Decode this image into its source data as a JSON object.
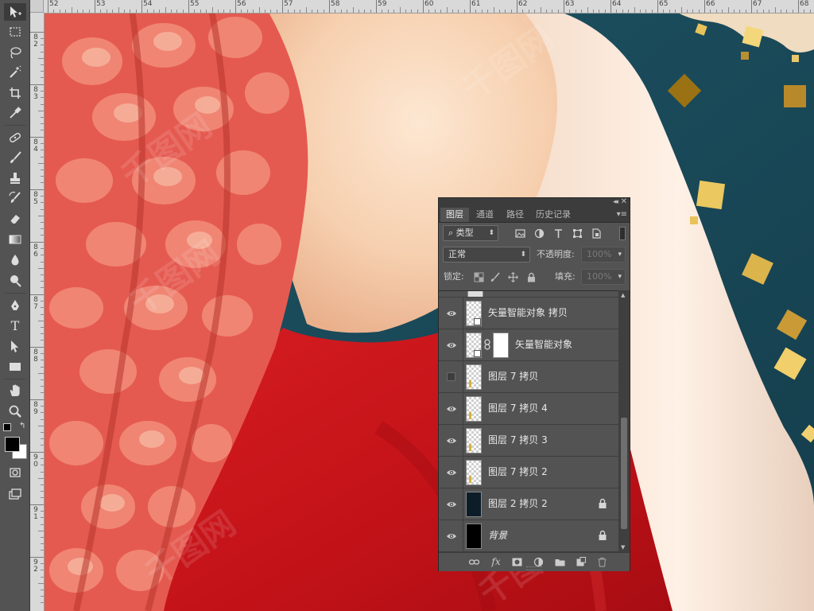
{
  "toolbar": {
    "tools": [
      "move-tool",
      "marquee-tool",
      "lasso-tool",
      "magic-wand-tool",
      "crop-tool",
      "eyedropper-tool",
      "healing-brush-tool",
      "brush-tool",
      "clone-stamp-tool",
      "history-brush-tool",
      "eraser-tool",
      "gradient-tool",
      "blur-tool",
      "dodge-tool",
      "pen-tool",
      "type-tool",
      "path-selection-tool",
      "rectangle-tool",
      "hand-tool",
      "zoom-tool"
    ],
    "type_tool_glyph": "T",
    "foreground_color": "#000000",
    "background_color": "#ffffff"
  },
  "rulers": {
    "horizontal_labels": [
      "52",
      "53",
      "54",
      "55",
      "56",
      "57",
      "58",
      "59",
      "60",
      "61",
      "62",
      "63",
      "64",
      "65",
      "66",
      "67",
      "68"
    ],
    "vertical_labels": [
      "8 2",
      "8 3",
      "8 4",
      "8 5",
      "8 6",
      "8 7",
      "8 8",
      "8 9",
      "9 0",
      "9 1",
      "9 2"
    ]
  },
  "canvas": {
    "background_color": "#1c4a5a",
    "dress_color": "#c8161b",
    "skin_color": "#f3c7a2",
    "hair_color": "#e35a55",
    "confetti_color": "#e2b547",
    "watermark_text": "千图网"
  },
  "layers_panel": {
    "collapse_glyph": "◂◂",
    "close_glyph": "✕",
    "menu_glyph": "▾≡",
    "tabs": [
      {
        "label": "图层",
        "active": true
      },
      {
        "label": "通道",
        "active": false
      },
      {
        "label": "路径",
        "active": false
      },
      {
        "label": "历史记录",
        "active": false
      }
    ],
    "filter": {
      "search_glyph": "⌕",
      "label": "类型",
      "arrow": "⬍"
    },
    "blend_mode": {
      "value": "正常",
      "arrow": "⬍"
    },
    "opacity": {
      "label": "不透明度:",
      "value": "100%",
      "arrow": "▾"
    },
    "lock": {
      "label": "锁定:"
    },
    "fill": {
      "label": "填充:",
      "value": "100%",
      "arrow": "▾"
    },
    "layers": [
      {
        "name": "矢量智能对象 拷贝",
        "visible": true,
        "thumb": "smart",
        "mask": false,
        "locked": false,
        "italic": false
      },
      {
        "name": "矢量智能对象",
        "visible": true,
        "thumb": "smart",
        "mask": true,
        "locked": false,
        "italic": false
      },
      {
        "name": "图层 7 拷贝",
        "visible": false,
        "thumb": "gold",
        "mask": false,
        "locked": false,
        "italic": false
      },
      {
        "name": "图层 7 拷贝 4",
        "visible": true,
        "thumb": "gold",
        "mask": false,
        "locked": false,
        "italic": false
      },
      {
        "name": "图层 7 拷贝 3",
        "visible": true,
        "thumb": "gold",
        "mask": false,
        "locked": false,
        "italic": false
      },
      {
        "name": "图层 7 拷贝 2",
        "visible": true,
        "thumb": "gold",
        "mask": false,
        "locked": false,
        "italic": false
      },
      {
        "name": "图层 2 拷贝 2",
        "visible": true,
        "thumb": "dark",
        "mask": false,
        "locked": true,
        "italic": false
      },
      {
        "name": "背景",
        "visible": true,
        "thumb": "black",
        "mask": false,
        "locked": true,
        "italic": true
      }
    ],
    "scroll_up_glyph": "▲",
    "scroll_down_glyph": "▼",
    "fx_label": "fx"
  }
}
